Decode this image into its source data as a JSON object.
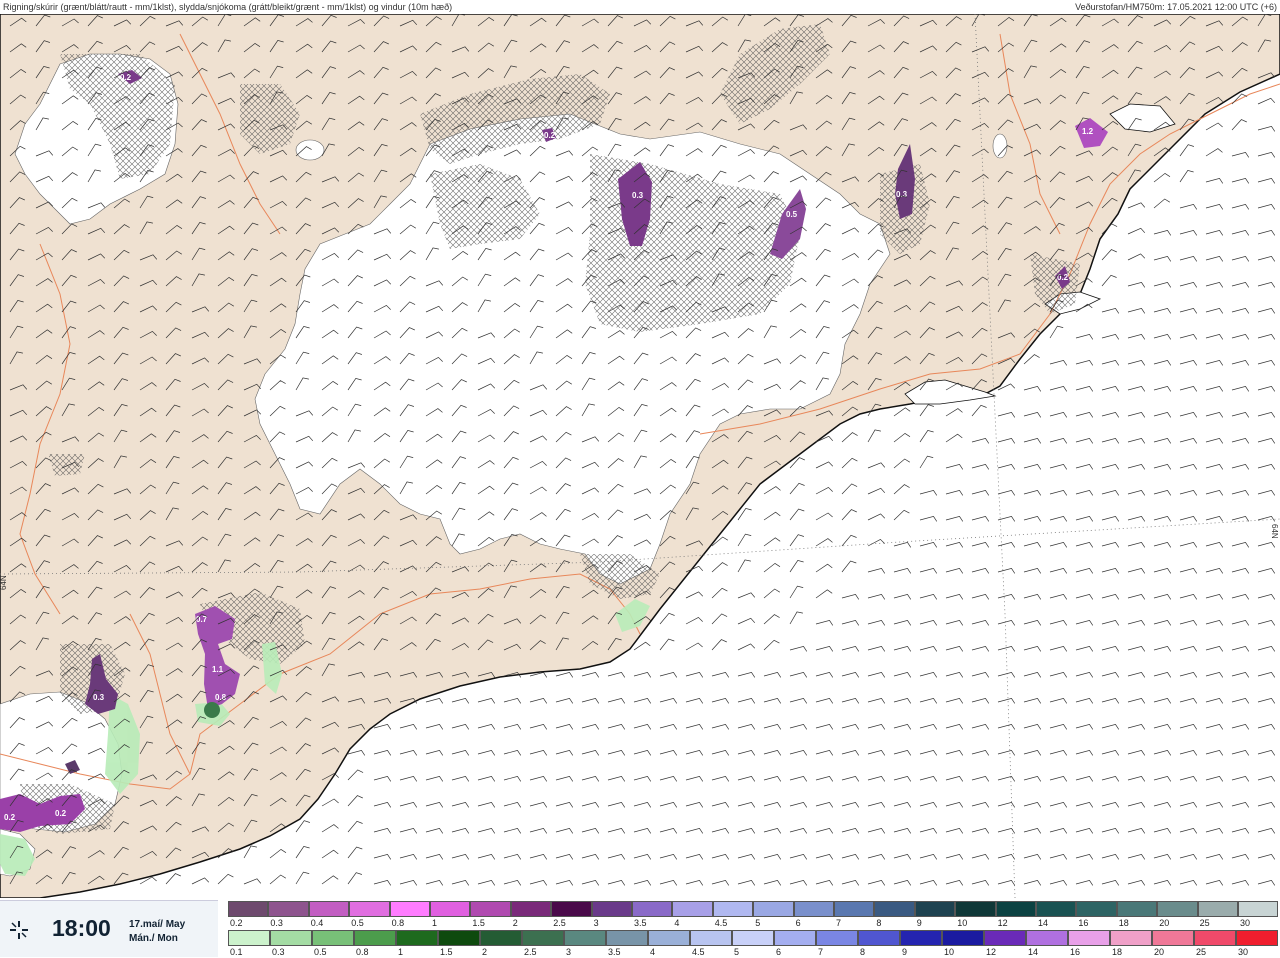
{
  "header": {
    "left_text": "Rigning/skúrir (grænt/blátt/rautt - mm/1klst), slydda/snjókoma (grátt/bleikt/grænt - mm/1klst) og vindur (10m hæð)",
    "right_text": "Veðurstofan/HM750m: 17.05.2021 12:00 UTC (+6)"
  },
  "footer": {
    "time": "18:00",
    "date_line1": "17.maí/ May",
    "date_line2": "Mán./ Mon"
  },
  "map": {
    "colors": {
      "land": "#efe1d1",
      "sea": "#ffffff",
      "glacier": "#ffffff",
      "road": "#e8875a",
      "coast": "#111111",
      "snow_precip": "#7a3a8a",
      "rain_precip": "#b8ecb8"
    },
    "latitude_label": "64N",
    "precip_labels": [
      "0.2",
      "0.2",
      "0.3",
      "0.5",
      "0.3",
      "1.2",
      "0.2",
      "0.7",
      "1.1",
      "0.8",
      "0.3",
      "0.2",
      "0.2"
    ]
  },
  "legend": {
    "snow_scale": {
      "labels": [
        "0.2",
        "0.3",
        "0.4",
        "0.5",
        "0.8",
        "1",
        "1.5",
        "2",
        "2.5",
        "3",
        "3.5",
        "4",
        "4.5",
        "5",
        "6",
        "7",
        "8",
        "9",
        "10",
        "12",
        "14",
        "16",
        "18",
        "20",
        "25",
        "30"
      ],
      "colors": [
        "#6e4a6e",
        "#8e548e",
        "#c25ec2",
        "#e06ee0",
        "#ff7cff",
        "#e060e0",
        "#b04ab0",
        "#7a2a7a",
        "#4a0a4a",
        "#6a3a8a",
        "#8a6ac8",
        "#a8a0e8",
        "#b0b8f0",
        "#9aa8e4",
        "#7a90cc",
        "#5a78b0",
        "#3a5a82",
        "#1e4250",
        "#103838",
        "#0c4242",
        "#1a5252",
        "#2e6464",
        "#4a7878",
        "#6a8c8c",
        "#9aacac",
        "#c8d4d4"
      ]
    },
    "rain_scale": {
      "labels": [
        "0.1",
        "0.3",
        "0.5",
        "0.8",
        "1",
        "1.5",
        "2",
        "2.5",
        "3",
        "3.5",
        "4",
        "4.5",
        "5",
        "6",
        "7",
        "8",
        "9",
        "10",
        "12",
        "14",
        "16",
        "18",
        "20",
        "25",
        "30"
      ],
      "colors": [
        "#ccf2cc",
        "#a4dca4",
        "#78c078",
        "#4c9c4c",
        "#1e6a1e",
        "#0e4a0e",
        "#245c34",
        "#3c7050",
        "#5a8880",
        "#7894a8",
        "#9ab0d8",
        "#b8c4f0",
        "#c8d0f8",
        "#a4aef0",
        "#7a86e4",
        "#5056d0",
        "#2424b0",
        "#1a1aa0",
        "#6a2ab8",
        "#b070e0",
        "#e8a0e8",
        "#f0a0c8",
        "#f07898",
        "#f04a6a",
        "#f01e2e"
      ]
    }
  }
}
